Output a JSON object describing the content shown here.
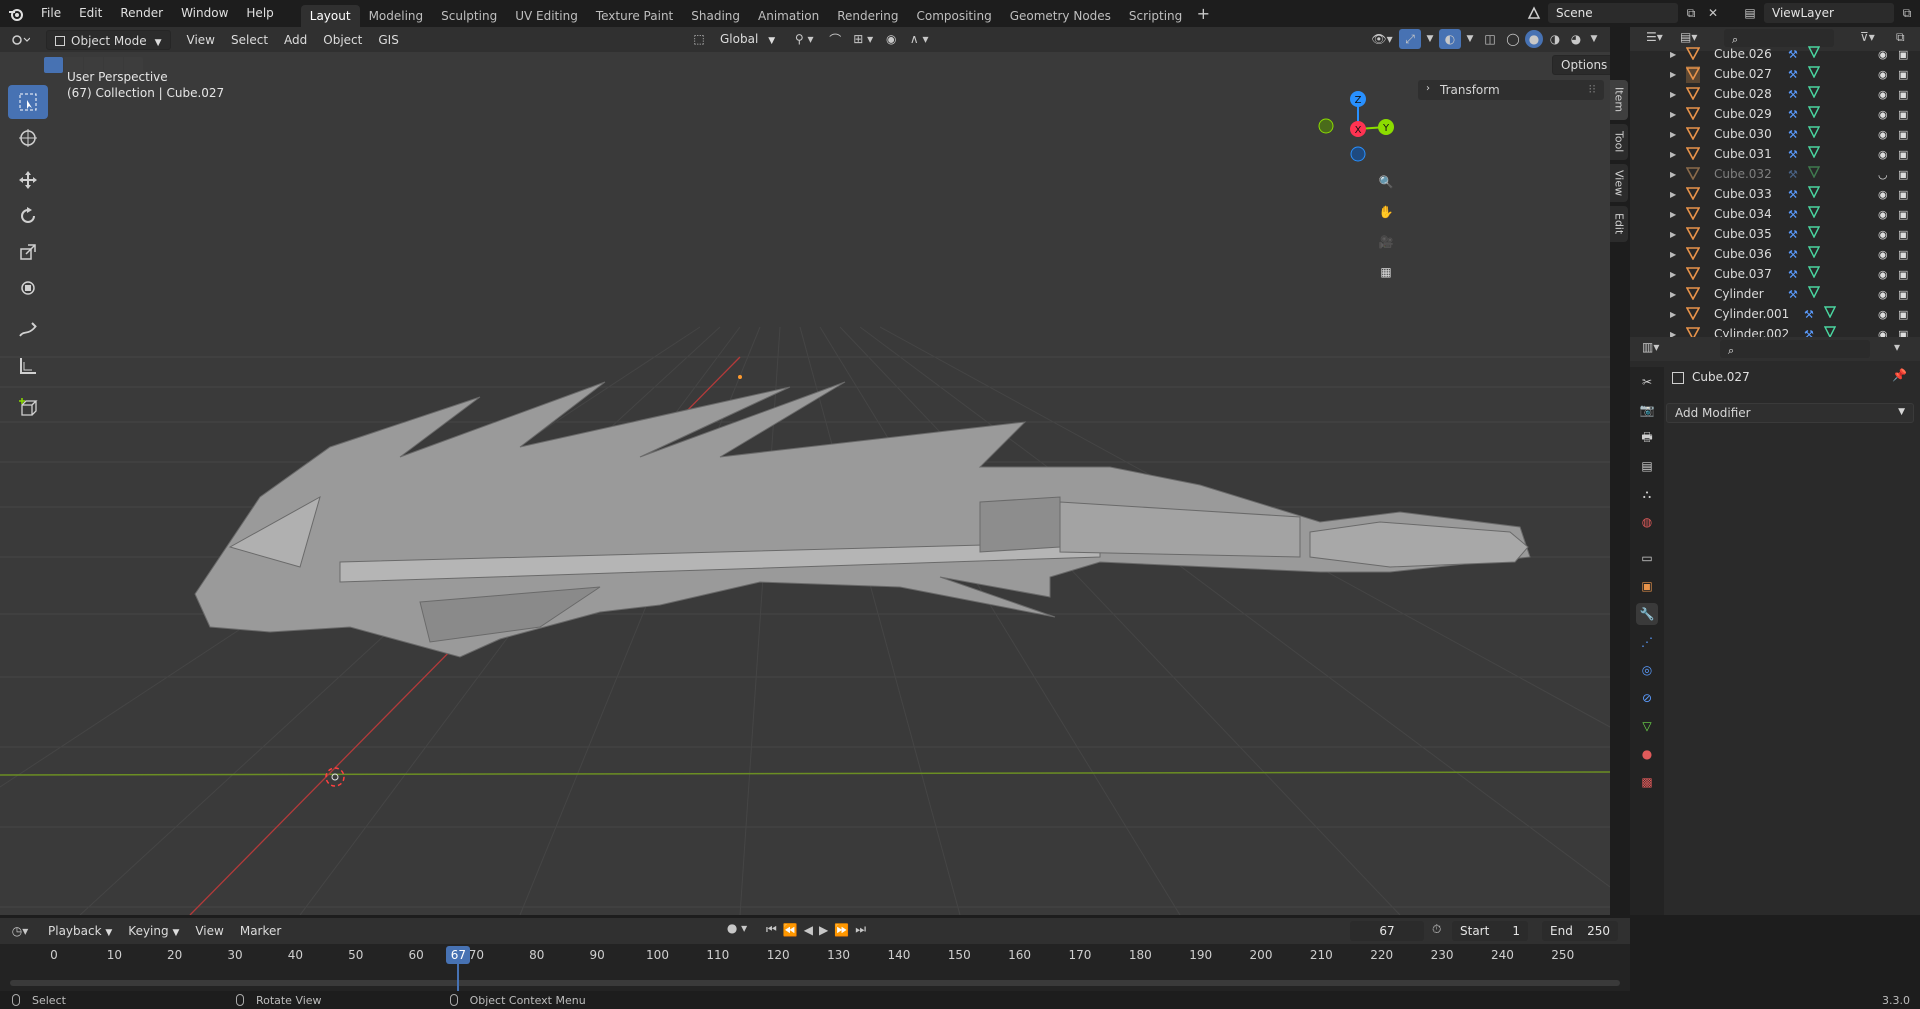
{
  "menubar": {
    "items": [
      "File",
      "Edit",
      "Render",
      "Window",
      "Help"
    ],
    "workspaces": [
      "Layout",
      "Modeling",
      "Sculpting",
      "UV Editing",
      "Texture Paint",
      "Shading",
      "Animation",
      "Rendering",
      "Compositing",
      "Geometry Nodes",
      "Scripting"
    ],
    "active_workspace": "Layout",
    "scene": "Scene",
    "view_layer": "ViewLayer"
  },
  "viewport_header": {
    "mode": "Object Mode",
    "menus": [
      "View",
      "Select",
      "Add",
      "Object",
      "GIS"
    ],
    "transform_orientation": "Global",
    "options_label": "Options"
  },
  "viewport": {
    "perspective_label": "User Perspective",
    "collection_label": "(67) Collection | Cube.027",
    "sidebar_panel": "Transform",
    "sidebar_tabs": [
      "Item",
      "Tool",
      "View",
      "Edit"
    ],
    "gizmo": {
      "z": "Z",
      "x": "X",
      "y": "Y"
    }
  },
  "outliner": {
    "rows": [
      {
        "name": "Cube.026",
        "dim": false
      },
      {
        "name": "Cube.027",
        "dim": false
      },
      {
        "name": "Cube.028",
        "dim": false
      },
      {
        "name": "Cube.029",
        "dim": false
      },
      {
        "name": "Cube.030",
        "dim": false
      },
      {
        "name": "Cube.031",
        "dim": false
      },
      {
        "name": "Cube.032",
        "dim": true
      },
      {
        "name": "Cube.033",
        "dim": false
      },
      {
        "name": "Cube.034",
        "dim": false
      },
      {
        "name": "Cube.035",
        "dim": false
      },
      {
        "name": "Cube.036",
        "dim": false
      },
      {
        "name": "Cube.037",
        "dim": false
      },
      {
        "name": "Cylinder",
        "dim": false
      },
      {
        "name": "Cylinder.001",
        "dim": false
      },
      {
        "name": "Cylinder.002",
        "dim": false
      }
    ]
  },
  "properties": {
    "object_name": "Cube.027",
    "add_modifier_label": "Add Modifier"
  },
  "timeline": {
    "menus": [
      "Playback",
      "Keying",
      "View",
      "Marker"
    ],
    "current_frame": "67",
    "start_label": "Start",
    "start_value": "1",
    "end_label": "End",
    "end_value": "250",
    "ticks": [
      "0",
      "10",
      "20",
      "30",
      "40",
      "50",
      "60",
      "70",
      "80",
      "90",
      "100",
      "110",
      "120",
      "130",
      "140",
      "150",
      "160",
      "170",
      "180",
      "190",
      "200",
      "210",
      "220",
      "230",
      "240",
      "250"
    ]
  },
  "statusbar": {
    "select": "Select",
    "rotate": "Rotate View",
    "context": "Object Context Menu",
    "version": "3.3.0"
  },
  "colors": {
    "accent": "#4772b3",
    "x_axis": "#ff3352",
    "y_axis": "#8bdc00",
    "z_axis": "#2890ff",
    "object_orange": "#e8934a"
  }
}
